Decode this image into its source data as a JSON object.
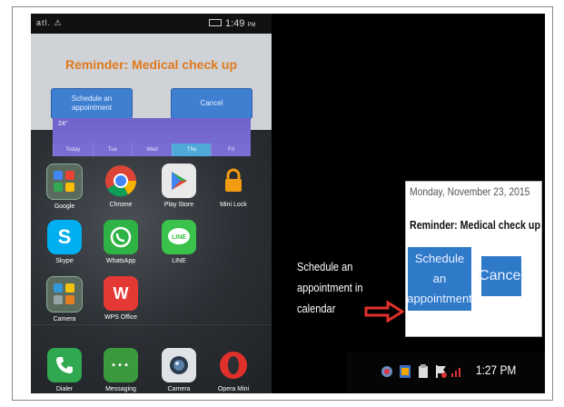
{
  "phone": {
    "status": {
      "signal": "atl. ⚠",
      "time": "1:49",
      "ampm": "PM"
    },
    "reminder": {
      "title": "Reminder: Medical check up",
      "schedule_label": "Schedule an appointment",
      "cancel_label": "Cancel"
    },
    "calendar_widget": {
      "temp": "24°",
      "days": [
        "Today",
        "Tue",
        "Wed",
        "Thu",
        "Fri"
      ]
    },
    "apps": [
      {
        "label": "Google",
        "icon": "google-folder-icon"
      },
      {
        "label": "Chrome",
        "icon": "chrome-icon"
      },
      {
        "label": "Play Store",
        "icon": "play-store-icon"
      },
      {
        "label": "Mini Lock",
        "icon": "lock-icon"
      },
      {
        "label": "Skype",
        "icon": "skype-icon"
      },
      {
        "label": "WhatsApp",
        "icon": "whatsapp-icon"
      },
      {
        "label": "LINE",
        "icon": "line-icon"
      },
      {
        "label": "Camera",
        "icon": "camera-folder-icon"
      },
      {
        "label": "WPS Office",
        "icon": "wps-office-icon"
      },
      {
        "label": "Dialer",
        "icon": "phone-icon"
      },
      {
        "label": "Messaging",
        "icon": "messaging-icon"
      },
      {
        "label": "Camera",
        "icon": "camera-icon"
      },
      {
        "label": "Opera Mini",
        "icon": "opera-mini-icon"
      }
    ]
  },
  "desktop": {
    "popup": {
      "date": "Monday, November 23, 2015",
      "title": "Reminder: Medical check up",
      "schedule_label": "Schedule an appointment",
      "cancel_label": "Cancel"
    },
    "annotation": "Schedule an appointment in calendar",
    "taskbar": {
      "time": "1:27 PM"
    }
  },
  "colors": {
    "reminder_title": "#e07a1f",
    "button_blue": "#2f79c9",
    "arrow_red": "#e0302a"
  }
}
